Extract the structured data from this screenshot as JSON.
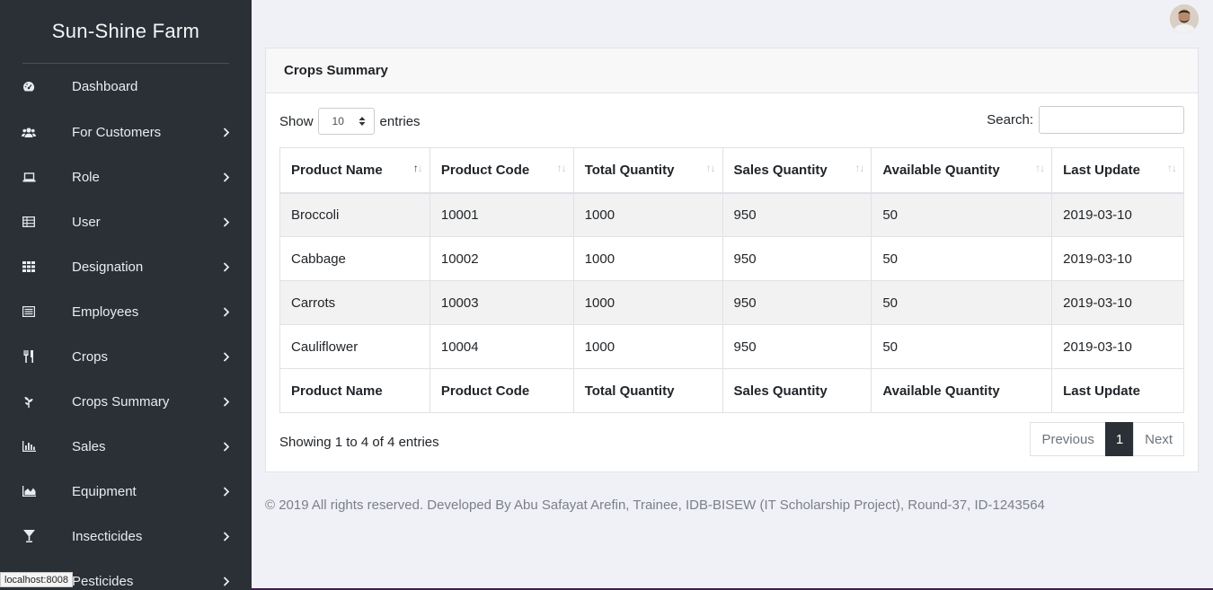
{
  "brand": "Sun-Shine Farm",
  "status_url": "localhost:8008",
  "sidebar": {
    "items": [
      {
        "label": "Dashboard",
        "icon": "dashboard-icon",
        "has_arrow": false
      },
      {
        "label": "For Customers",
        "icon": "users-icon",
        "has_arrow": true
      },
      {
        "label": "Role",
        "icon": "laptop-icon",
        "has_arrow": true
      },
      {
        "label": "User",
        "icon": "table-icon",
        "has_arrow": true
      },
      {
        "label": "Designation",
        "icon": "grid-icon",
        "has_arrow": true
      },
      {
        "label": "Employees",
        "icon": "list-icon",
        "has_arrow": true
      },
      {
        "label": "Crops",
        "icon": "utensils-icon",
        "has_arrow": true
      },
      {
        "label": "Crops Summary",
        "icon": "seedling-icon",
        "has_arrow": true
      },
      {
        "label": "Sales",
        "icon": "bar-chart-icon",
        "has_arrow": true
      },
      {
        "label": "Equipment",
        "icon": "area-chart-icon",
        "has_arrow": true
      },
      {
        "label": "Insecticides",
        "icon": "funnel-icon",
        "has_arrow": true
      },
      {
        "label": "Pesticides",
        "icon": "pesticide-icon",
        "has_arrow": true
      }
    ]
  },
  "card": {
    "title": "Crops Summary",
    "show_label": "Show",
    "entries_label": "entries",
    "page_length": "10",
    "search_label": "Search:",
    "search_value": ""
  },
  "table": {
    "columns": [
      "Product Name",
      "Product Code",
      "Total Quantity",
      "Sales Quantity",
      "Available Quantity",
      "Last Update"
    ],
    "rows": [
      [
        "Broccoli",
        "10001",
        "1000",
        "950",
        "50",
        "2019-03-10"
      ],
      [
        "Cabbage",
        "10002",
        "1000",
        "950",
        "50",
        "2019-03-10"
      ],
      [
        "Carrots",
        "10003",
        "1000",
        "950",
        "50",
        "2019-03-10"
      ],
      [
        "Cauliflower",
        "10004",
        "1000",
        "950",
        "50",
        "2019-03-10"
      ]
    ],
    "sorted_column": "Product Name"
  },
  "info": "Showing 1 to 4 of 4 entries",
  "pagination": {
    "previous": "Previous",
    "current": "1",
    "next": "Next"
  },
  "footer": "© 2019 All rights reserved. Developed By Abu Safayat Arefin, Trainee, IDB-BISEW (IT Scholarship Project), Round-37, ID-1243564",
  "colors": {
    "sidebar": "#2b3036",
    "background": "#f0f1f6",
    "active_page": "#2b3036"
  }
}
